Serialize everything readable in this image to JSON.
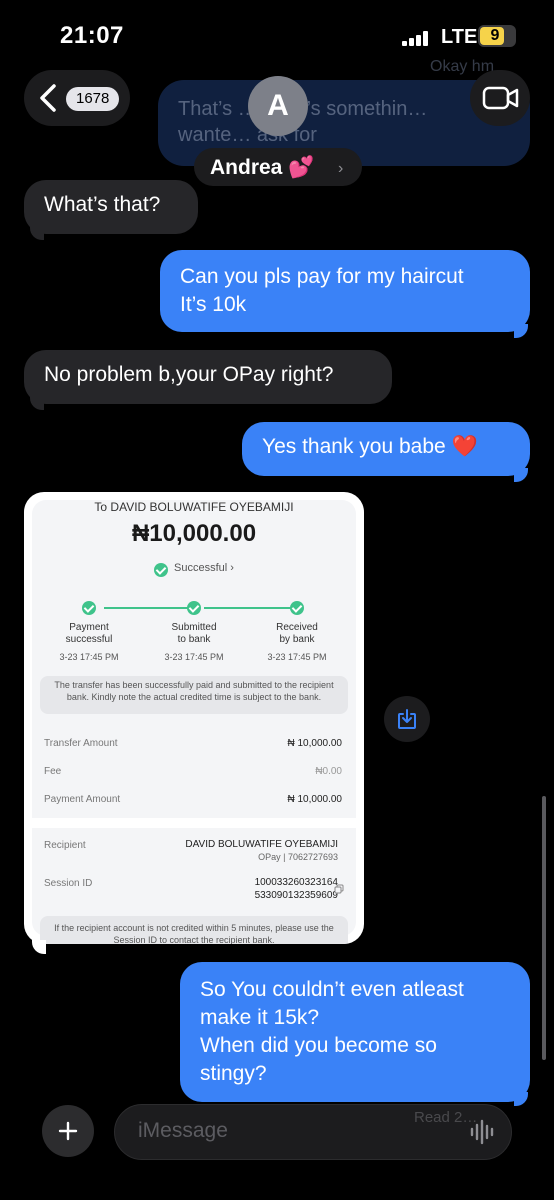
{
  "status_bar": {
    "time": "21:07",
    "network": "LTE",
    "battery_level": "9",
    "top_peek_text": "Okay hm"
  },
  "header": {
    "back_count": "1678",
    "contact_initial": "A",
    "contact_name": "Andrea 💕",
    "blurred_message": [
      "That’s … Here’s somethin…",
      "wante… ask for"
    ]
  },
  "messages": [
    {
      "direction": "incoming",
      "lines": [
        "What’s that?"
      ]
    },
    {
      "direction": "outgoing",
      "lines": [
        "Can you pls pay for my haircut",
        "It’s 10k"
      ]
    },
    {
      "direction": "incoming",
      "lines": [
        "No problem b,your OPay right?"
      ]
    },
    {
      "direction": "outgoing",
      "lines": [
        "Yes thank you babe ❤️"
      ]
    },
    {
      "direction": "outgoing",
      "lines": [
        "So You couldn’t even atleast",
        "make it 15k?",
        "When did you become so",
        "stingy?"
      ]
    }
  ],
  "receipt": {
    "to_line": "To DAVID BOLUWATIFE OYEBAMIJI",
    "amount": "₦10,000.00",
    "status": "Successful",
    "steps": [
      {
        "label_1": "Payment",
        "label_2": "successful",
        "date": "3-23 17:45 PM"
      },
      {
        "label_1": "Submitted",
        "label_2": "to bank",
        "date": "3-23 17:45 PM"
      },
      {
        "label_1": "Received",
        "label_2": "by bank",
        "date": "3-23 17:45 PM"
      }
    ],
    "note": "The transfer has been successfully paid and submitted to the recipient bank. Kindly note the actual credited time is subject to the bank.",
    "transfer_amount_label": "Transfer Amount",
    "transfer_amount_value": "₦ 10,000.00",
    "fee_label": "Fee",
    "fee_value": "₦0.00",
    "payment_amount_label": "Payment Amount",
    "payment_amount_value": "₦ 10,000.00",
    "recipient_label": "Recipient",
    "recipient_name": "DAVID BOLUWATIFE OYEBAMIJI",
    "recipient_bank": "OPay | 7062727693",
    "session_label": "Session ID",
    "session_line_1": "100033260323164",
    "session_line_2": "533090132359609",
    "footnote": "If the recipient account is not credited within 5 minutes, please use the Session ID to contact the recipient bank."
  },
  "input": {
    "placeholder": "iMessage",
    "ghost_read": [
      "Read 2…"
    ]
  },
  "colors": {
    "outgoing": "#3a82f7",
    "incoming": "#262629",
    "background": "#000000",
    "success": "#3fc38b"
  }
}
